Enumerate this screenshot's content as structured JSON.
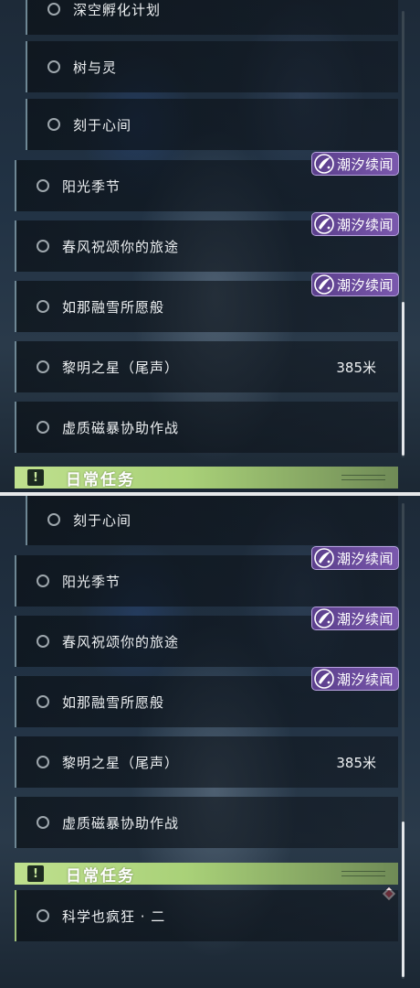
{
  "colors": {
    "badge_bg": "#6a4a9c",
    "daily_header": "#b3d784",
    "row_accent": "#6e8794",
    "marker": "#d84a5a"
  },
  "top": {
    "sub_quests": [
      "深空孵化计划",
      "树与灵",
      "刻于心间"
    ],
    "quests": [
      {
        "label": "阳光季节",
        "badge": "潮汐续闻"
      },
      {
        "label": "春风祝颂你的旅途",
        "badge": "潮汐续闻"
      },
      {
        "label": "如那融雪所愿般",
        "badge": "潮汐续闻"
      },
      {
        "label": "黎明之星（尾声）",
        "distance": "385米"
      },
      {
        "label": "虚质磁暴协助作战"
      }
    ],
    "section_header": "日常任务"
  },
  "bottom": {
    "sub_quests": [
      "刻于心间"
    ],
    "quests": [
      {
        "label": "阳光季节",
        "badge": "潮汐续闻"
      },
      {
        "label": "春风祝颂你的旅途",
        "badge": "潮汐续闻"
      },
      {
        "label": "如那融雪所愿般",
        "badge": "潮汐续闻"
      },
      {
        "label": "黎明之星（尾声）",
        "distance": "385米"
      },
      {
        "label": "虚质磁暴协助作战"
      }
    ],
    "section_header": "日常任务",
    "daily_quests": [
      {
        "label": "科学也疯狂 · 二"
      }
    ]
  },
  "icons": [
    "circle-status-icon",
    "badge-emblem-icon",
    "exclamation-icon",
    "map-marker-icon"
  ]
}
